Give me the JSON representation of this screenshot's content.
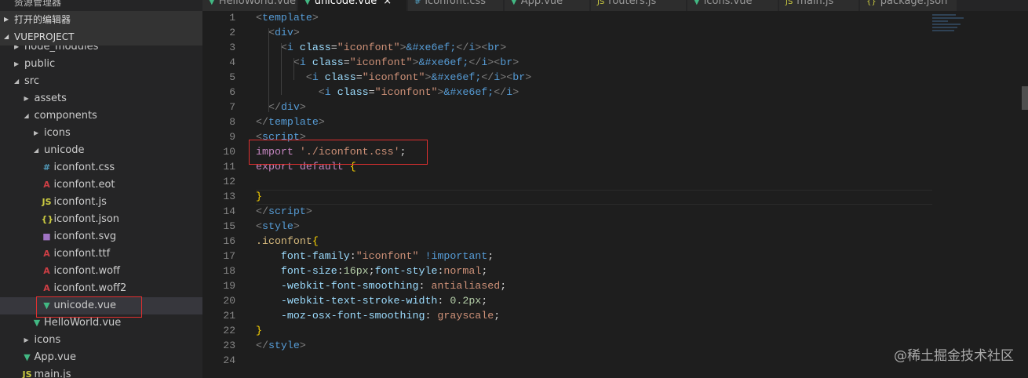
{
  "sidebar": {
    "title": "资源管理器",
    "open_editors": "打开的编辑器",
    "project": "VUEPROJECT",
    "items": [
      {
        "label": "node_modules",
        "depth": 1,
        "kind": "folder",
        "open": false
      },
      {
        "label": "public",
        "depth": 1,
        "kind": "folder",
        "open": false
      },
      {
        "label": "src",
        "depth": 1,
        "kind": "folder",
        "open": true
      },
      {
        "label": "assets",
        "depth": 2,
        "kind": "folder",
        "open": false
      },
      {
        "label": "components",
        "depth": 2,
        "kind": "folder",
        "open": true
      },
      {
        "label": "icons",
        "depth": 3,
        "kind": "folder",
        "open": false
      },
      {
        "label": "unicode",
        "depth": 3,
        "kind": "folder",
        "open": true
      },
      {
        "label": "iconfont.css",
        "depth": 4,
        "kind": "css"
      },
      {
        "label": "iconfont.eot",
        "depth": 4,
        "kind": "font"
      },
      {
        "label": "iconfont.js",
        "depth": 4,
        "kind": "js"
      },
      {
        "label": "iconfont.json",
        "depth": 4,
        "kind": "json"
      },
      {
        "label": "iconfont.svg",
        "depth": 4,
        "kind": "svg"
      },
      {
        "label": "iconfont.ttf",
        "depth": 4,
        "kind": "font"
      },
      {
        "label": "iconfont.woff",
        "depth": 4,
        "kind": "font"
      },
      {
        "label": "iconfont.woff2",
        "depth": 4,
        "kind": "font"
      },
      {
        "label": "unicode.vue",
        "depth": 4,
        "kind": "vue",
        "selected": true
      },
      {
        "label": "HelloWorld.vue",
        "depth": 3,
        "kind": "vue"
      },
      {
        "label": "icons",
        "depth": 2,
        "kind": "folder",
        "open": false
      },
      {
        "label": "App.vue",
        "depth": 2,
        "kind": "vue"
      },
      {
        "label": "main.js",
        "depth": 2,
        "kind": "js"
      }
    ]
  },
  "tabs": [
    {
      "label": "HelloWorld.vue",
      "kind": "vue"
    },
    {
      "label": "unicode.vue",
      "kind": "vue",
      "active": true,
      "close": "×"
    },
    {
      "label": "iconfont.css",
      "kind": "css"
    },
    {
      "label": "App.vue",
      "kind": "vue"
    },
    {
      "label": "routers.js",
      "kind": "js"
    },
    {
      "label": "icons.vue",
      "kind": "vue"
    },
    {
      "label": "main.js",
      "kind": "js"
    },
    {
      "label": "package.json",
      "kind": "json"
    }
  ],
  "code": [
    [
      [
        "<",
        "br"
      ],
      [
        "template",
        "tag"
      ],
      [
        ">",
        "br"
      ]
    ],
    [
      [
        "  ",
        "p"
      ],
      [
        "<",
        "br"
      ],
      [
        "div",
        "tag"
      ],
      [
        ">",
        "br"
      ]
    ],
    [
      [
        "    ",
        "p"
      ],
      [
        "<",
        "br"
      ],
      [
        "i",
        "tag"
      ],
      [
        " ",
        "p"
      ],
      [
        "class",
        "attr"
      ],
      [
        "=",
        "p"
      ],
      [
        "\"iconfont\"",
        "str"
      ],
      [
        ">",
        "br"
      ],
      [
        "&#xe6ef;",
        "tag"
      ],
      [
        "</",
        "br"
      ],
      [
        "i",
        "tag"
      ],
      [
        "><",
        "br"
      ],
      [
        "br",
        "tag"
      ],
      [
        ">",
        "br"
      ]
    ],
    [
      [
        "      ",
        "p"
      ],
      [
        "<",
        "br"
      ],
      [
        "i",
        "tag"
      ],
      [
        " ",
        "p"
      ],
      [
        "class",
        "attr"
      ],
      [
        "=",
        "p"
      ],
      [
        "\"iconfont\"",
        "str"
      ],
      [
        ">",
        "br"
      ],
      [
        "&#xe6ef;",
        "tag"
      ],
      [
        "</",
        "br"
      ],
      [
        "i",
        "tag"
      ],
      [
        "><",
        "br"
      ],
      [
        "br",
        "tag"
      ],
      [
        ">",
        "br"
      ]
    ],
    [
      [
        "        ",
        "p"
      ],
      [
        "<",
        "br"
      ],
      [
        "i",
        "tag"
      ],
      [
        " ",
        "p"
      ],
      [
        "class",
        "attr"
      ],
      [
        "=",
        "p"
      ],
      [
        "\"iconfont\"",
        "str"
      ],
      [
        ">",
        "br"
      ],
      [
        "&#xe6ef;",
        "tag"
      ],
      [
        "</",
        "br"
      ],
      [
        "i",
        "tag"
      ],
      [
        "><",
        "br"
      ],
      [
        "br",
        "tag"
      ],
      [
        ">",
        "br"
      ]
    ],
    [
      [
        "          ",
        "p"
      ],
      [
        "<",
        "br"
      ],
      [
        "i",
        "tag"
      ],
      [
        " ",
        "p"
      ],
      [
        "class",
        "attr"
      ],
      [
        "=",
        "p"
      ],
      [
        "\"iconfont\"",
        "str"
      ],
      [
        ">",
        "br"
      ],
      [
        "&#xe6ef;",
        "tag"
      ],
      [
        "</",
        "br"
      ],
      [
        "i",
        "tag"
      ],
      [
        ">",
        "br"
      ]
    ],
    [
      [
        "  ",
        "p"
      ],
      [
        "</",
        "br"
      ],
      [
        "div",
        "tag"
      ],
      [
        ">",
        "br"
      ]
    ],
    [
      [
        "</",
        "br"
      ],
      [
        "template",
        "tag"
      ],
      [
        ">",
        "br"
      ]
    ],
    [
      [
        "<",
        "br"
      ],
      [
        "script",
        "tag"
      ],
      [
        ">",
        "br"
      ]
    ],
    [
      [
        "import",
        "kw"
      ],
      [
        " ",
        "p"
      ],
      [
        "'./iconfont.css'",
        "str"
      ],
      [
        ";",
        "p"
      ]
    ],
    [
      [
        "export",
        "kw"
      ],
      [
        " ",
        "p"
      ],
      [
        "default",
        "kw"
      ],
      [
        " ",
        "p"
      ],
      [
        "{",
        "brace"
      ]
    ],
    [],
    [
      [
        "}",
        "brace"
      ]
    ],
    [
      [
        "</",
        "br"
      ],
      [
        "script",
        "tag"
      ],
      [
        ">",
        "br"
      ]
    ],
    [
      [
        "<",
        "br"
      ],
      [
        "style",
        "tag"
      ],
      [
        ">",
        "br"
      ]
    ],
    [
      [
        ".iconfont",
        "sel"
      ],
      [
        "{",
        "brace"
      ]
    ],
    [
      [
        "    ",
        "p"
      ],
      [
        "font-family",
        "attr"
      ],
      [
        ":",
        "p"
      ],
      [
        "\"iconfont\"",
        "str"
      ],
      [
        " ",
        "p"
      ],
      [
        "!important",
        "tag"
      ],
      [
        ";",
        "p"
      ]
    ],
    [
      [
        "    ",
        "p"
      ],
      [
        "font-size",
        "attr"
      ],
      [
        ":",
        "p"
      ],
      [
        "16px",
        "num"
      ],
      [
        ";",
        "p"
      ],
      [
        "font-style",
        "attr"
      ],
      [
        ":",
        "p"
      ],
      [
        "normal",
        "str"
      ],
      [
        ";",
        "p"
      ]
    ],
    [
      [
        "    ",
        "p"
      ],
      [
        "-webkit-font-smoothing",
        "attr"
      ],
      [
        ": ",
        "p"
      ],
      [
        "antialiased",
        "str"
      ],
      [
        ";",
        "p"
      ]
    ],
    [
      [
        "    ",
        "p"
      ],
      [
        "-webkit-text-stroke-width",
        "attr"
      ],
      [
        ": ",
        "p"
      ],
      [
        "0.2px",
        "num"
      ],
      [
        ";",
        "p"
      ]
    ],
    [
      [
        "    ",
        "p"
      ],
      [
        "-moz-osx-font-smoothing",
        "attr"
      ],
      [
        ": ",
        "p"
      ],
      [
        "grayscale",
        "str"
      ],
      [
        ";",
        "p"
      ]
    ],
    [
      [
        "}",
        "brace"
      ]
    ],
    [
      [
        "</",
        "br"
      ],
      [
        "style",
        "tag"
      ],
      [
        ">",
        "br"
      ]
    ],
    []
  ],
  "watermark": "@稀土掘金技术社区"
}
